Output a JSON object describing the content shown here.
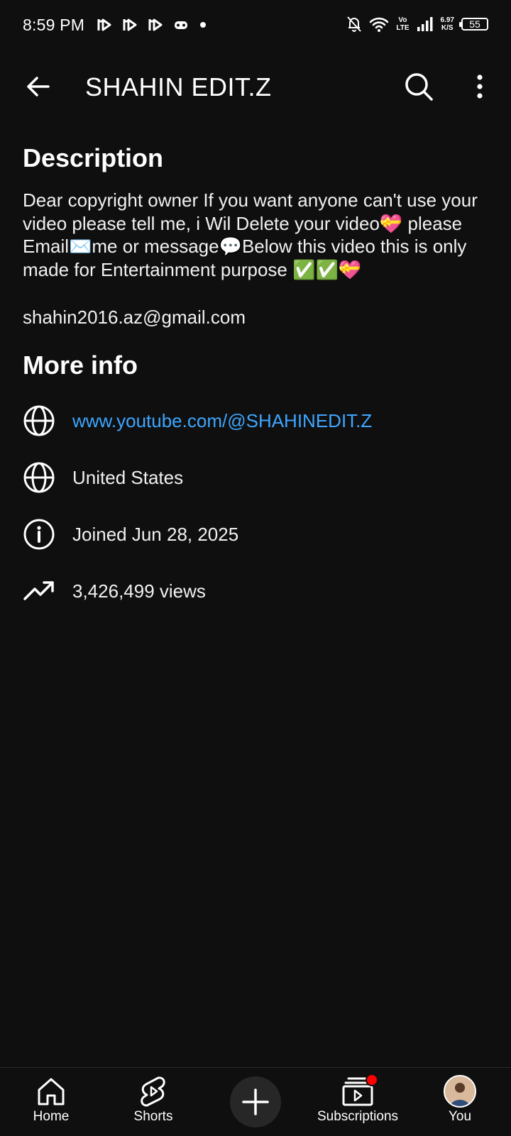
{
  "status_bar": {
    "time": "8:59 PM",
    "network_top": "Vo",
    "network_bottom": "LTE",
    "speed_top": "6.97",
    "speed_bottom": "K/S",
    "battery": "55"
  },
  "header": {
    "title": "SHAHIN EDIT.Z",
    "back_icon": "arrow-left",
    "search_icon": "search",
    "more_icon": "more-vertical"
  },
  "description": {
    "heading": "Description",
    "body": "Dear copyright owner If you want anyone can't use your video please tell me, i Wil Delete your video💝 please Email✉️me or message💬Below this video this is only made for Entertainment purpose ✅✅💝",
    "email": "shahin2016.az@gmail.com"
  },
  "more_info": {
    "heading": "More info",
    "items": [
      {
        "icon": "globe",
        "text": "www.youtube.com/@SHAHINEDIT.Z",
        "is_link": true
      },
      {
        "icon": "globe",
        "text": "United States",
        "is_link": false
      },
      {
        "icon": "info-circle",
        "text": "Joined Jun 28, 2025",
        "is_link": false
      },
      {
        "icon": "trending-up",
        "text": "3,426,499 views",
        "is_link": false
      }
    ]
  },
  "bottom_nav": {
    "items": [
      {
        "label": "Home",
        "icon": "home"
      },
      {
        "label": "Shorts",
        "icon": "shorts"
      },
      {
        "label": "",
        "icon": "plus"
      },
      {
        "label": "Subscriptions",
        "icon": "subscriptions",
        "badge": true
      },
      {
        "label": "You",
        "icon": "avatar"
      }
    ]
  },
  "colors": {
    "background": "#0f0f0f",
    "text": "#f1f1f1",
    "link": "#3ea6ff",
    "badge": "#ff0000"
  }
}
